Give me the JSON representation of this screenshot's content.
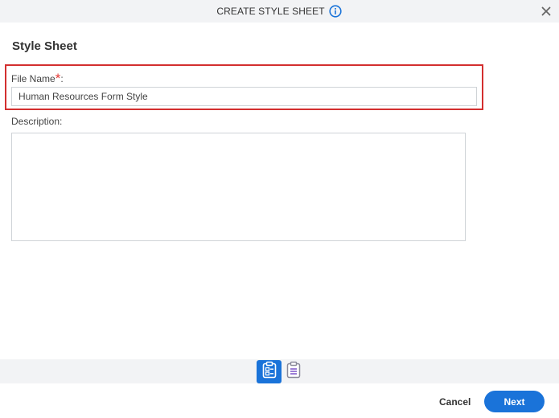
{
  "dialog": {
    "title": "CREATE STYLE SHEET",
    "close_icon": "close-icon",
    "info_icon": "info-icon"
  },
  "form": {
    "section_title": "Style Sheet",
    "file_name": {
      "label": "File Name",
      "required_mark": "*",
      "colon": ":",
      "value": "Human Resources Form Style"
    },
    "description": {
      "label": "Description:",
      "value": ""
    }
  },
  "steps": [
    {
      "icon": "clipboard-form-icon",
      "state": "active"
    },
    {
      "icon": "clipboard-list-icon",
      "state": "inactive"
    }
  ],
  "footer": {
    "cancel_label": "Cancel",
    "next_label": "Next"
  },
  "colors": {
    "accent": "#1a73d9",
    "required": "#e53935",
    "highlight_border": "#d32f2f",
    "header_bg": "#f2f3f5"
  }
}
